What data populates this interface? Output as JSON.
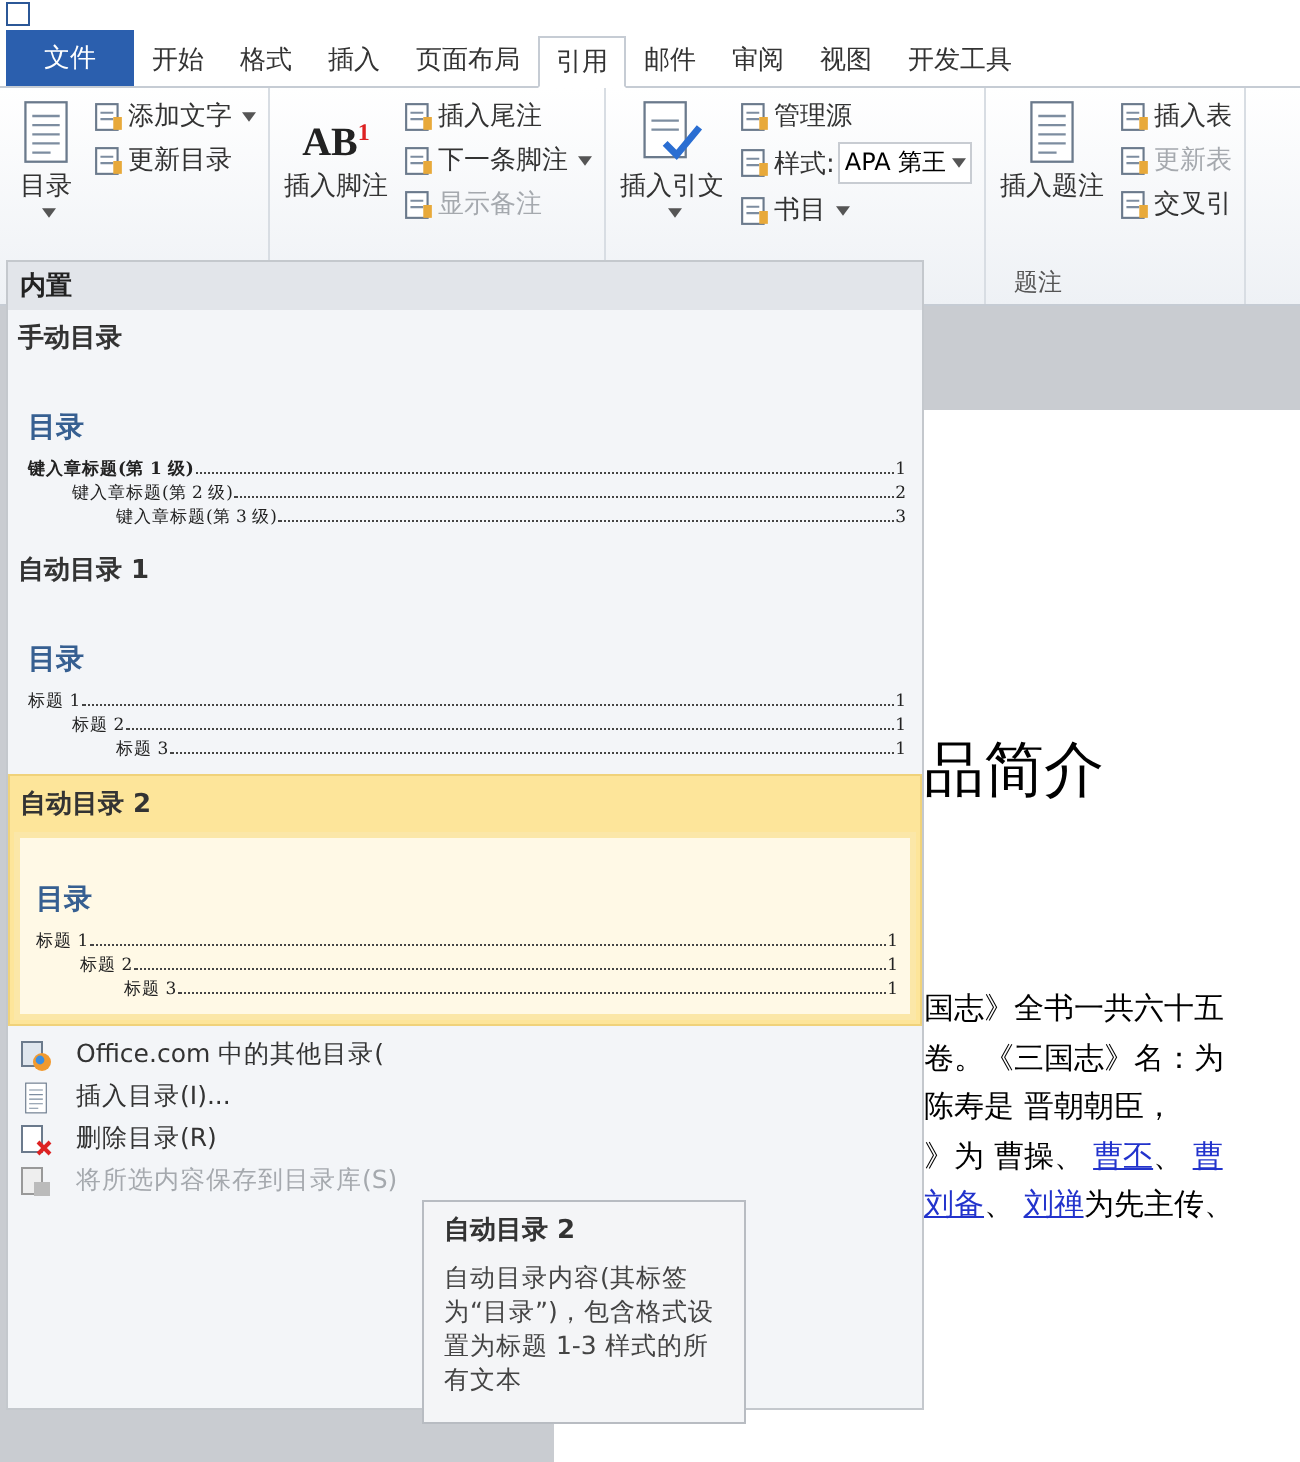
{
  "tabs": [
    {
      "label": "文件",
      "kind": "file",
      "selected": false
    },
    {
      "label": "开始",
      "kind": "tab",
      "selected": false
    },
    {
      "label": "格式",
      "kind": "tab",
      "selected": false
    },
    {
      "label": "插入",
      "kind": "tab",
      "selected": false
    },
    {
      "label": "页面布局",
      "kind": "tab",
      "selected": false
    },
    {
      "label": "引用",
      "kind": "tab",
      "selected": true
    },
    {
      "label": "邮件",
      "kind": "tab",
      "selected": false
    },
    {
      "label": "审阅",
      "kind": "tab",
      "selected": false
    },
    {
      "label": "视图",
      "kind": "tab",
      "selected": false
    },
    {
      "label": "开发工具",
      "kind": "tab",
      "selected": false
    }
  ],
  "ribbon": {
    "groups": [
      {
        "kind": "toc",
        "large": {
          "label": "目录",
          "dropdown": true
        },
        "small": [
          {
            "label": "添加文字",
            "dropdown": true,
            "disabled": false
          },
          {
            "label": "更新目录",
            "dropdown": false,
            "disabled": false
          }
        ]
      },
      {
        "kind": "footnote",
        "icon_text": "AB",
        "icon_sup": "1",
        "large": {
          "label": "插入脚注",
          "dropdown": false
        },
        "small": [
          {
            "label": "插入尾注",
            "dropdown": false,
            "disabled": false
          },
          {
            "label": "下一条脚注",
            "dropdown": true,
            "disabled": false
          },
          {
            "label": "显示备注",
            "dropdown": false,
            "disabled": true
          }
        ]
      },
      {
        "kind": "citation",
        "large": {
          "label": "插入引文",
          "dropdown": true
        },
        "small": [
          {
            "label": "管理源",
            "dropdown": false,
            "disabled": false
          },
          {
            "label": "样式:",
            "disabled": false,
            "combo": "APA 第王"
          },
          {
            "label": "书目",
            "dropdown": true,
            "disabled": false
          }
        ]
      },
      {
        "kind": "caption",
        "large": {
          "label": "插入题注",
          "dropdown": false
        },
        "small": [
          {
            "label": "插入表",
            "dropdown": false,
            "disabled": false
          },
          {
            "label": "更新表",
            "dropdown": false,
            "disabled": true
          },
          {
            "label": "交叉引",
            "dropdown": false,
            "disabled": false
          }
        ],
        "group_label": "题注"
      }
    ]
  },
  "gallery": {
    "section": "内置",
    "entries": [
      {
        "title": "手动目录",
        "selected": false,
        "preview": {
          "kind": "manual",
          "heading": "目录",
          "lines": [
            {
              "text": "键入章标题(第 1 级)",
              "page": "1",
              "children": [
                {
                  "text": "键入章标题(第 2 级)",
                  "page": "2",
                  "children": [
                    {
                      "text": "键入章标题(第 3 级)",
                      "page": "3"
                    }
                  ]
                }
              ]
            }
          ]
        }
      },
      {
        "title": "自动目录 1",
        "selected": false,
        "preview": {
          "kind": "auto",
          "heading": "目录",
          "lines": [
            {
              "text": "标题 1",
              "page": "1",
              "children": [
                {
                  "text": "标题 2",
                  "page": "1",
                  "children": [
                    {
                      "text": "标题 3",
                      "page": "1"
                    }
                  ]
                }
              ]
            }
          ]
        }
      },
      {
        "title": "自动目录 2",
        "selected": true,
        "preview": {
          "kind": "auto",
          "heading": "目录",
          "lines": [
            {
              "text": "标题 1",
              "page": "1",
              "children": [
                {
                  "text": "标题 2",
                  "page": "1",
                  "children": [
                    {
                      "text": "标题 3",
                      "page": "1"
                    }
                  ]
                }
              ]
            }
          ]
        }
      }
    ],
    "menu": [
      {
        "label": "Office.com 中的其他目录(",
        "kind": "office",
        "disabled": false
      },
      {
        "label": "插入目录(I)...",
        "kind": "insert",
        "disabled": false
      },
      {
        "label": "删除目录(R)",
        "kind": "delete",
        "disabled": false
      },
      {
        "label": "将所选内容保存到目录库(S)",
        "kind": "save",
        "disabled": true
      }
    ]
  },
  "tooltip": {
    "title": "自动目录 2",
    "body": "自动目录内容(其标签为“目录”)，包含格式设置为标题 1-3 样式的所有文本"
  },
  "document": {
    "heading": "品简介",
    "lines": [
      [
        {
          "text": "国志》全书一共六十五",
          "link": false
        }
      ],
      [
        {
          "text": "卷。《三国志》名：为",
          "link": false
        }
      ],
      [
        {
          "text": "陈寿是 晋朝朝臣，",
          "link": false
        }
      ],
      [
        {
          "text": "》为 曹操、 ",
          "link": false
        },
        {
          "text": "曹丕",
          "link": true
        },
        {
          "text": "、 ",
          "link": false
        },
        {
          "text": "曹",
          "link": true
        }
      ],
      [
        {
          "text": "刘备",
          "link": true
        },
        {
          "text": "、 ",
          "link": false
        },
        {
          "text": "刘禅",
          "link": true
        },
        {
          "text": "为先主传、",
          "link": false
        }
      ]
    ]
  }
}
